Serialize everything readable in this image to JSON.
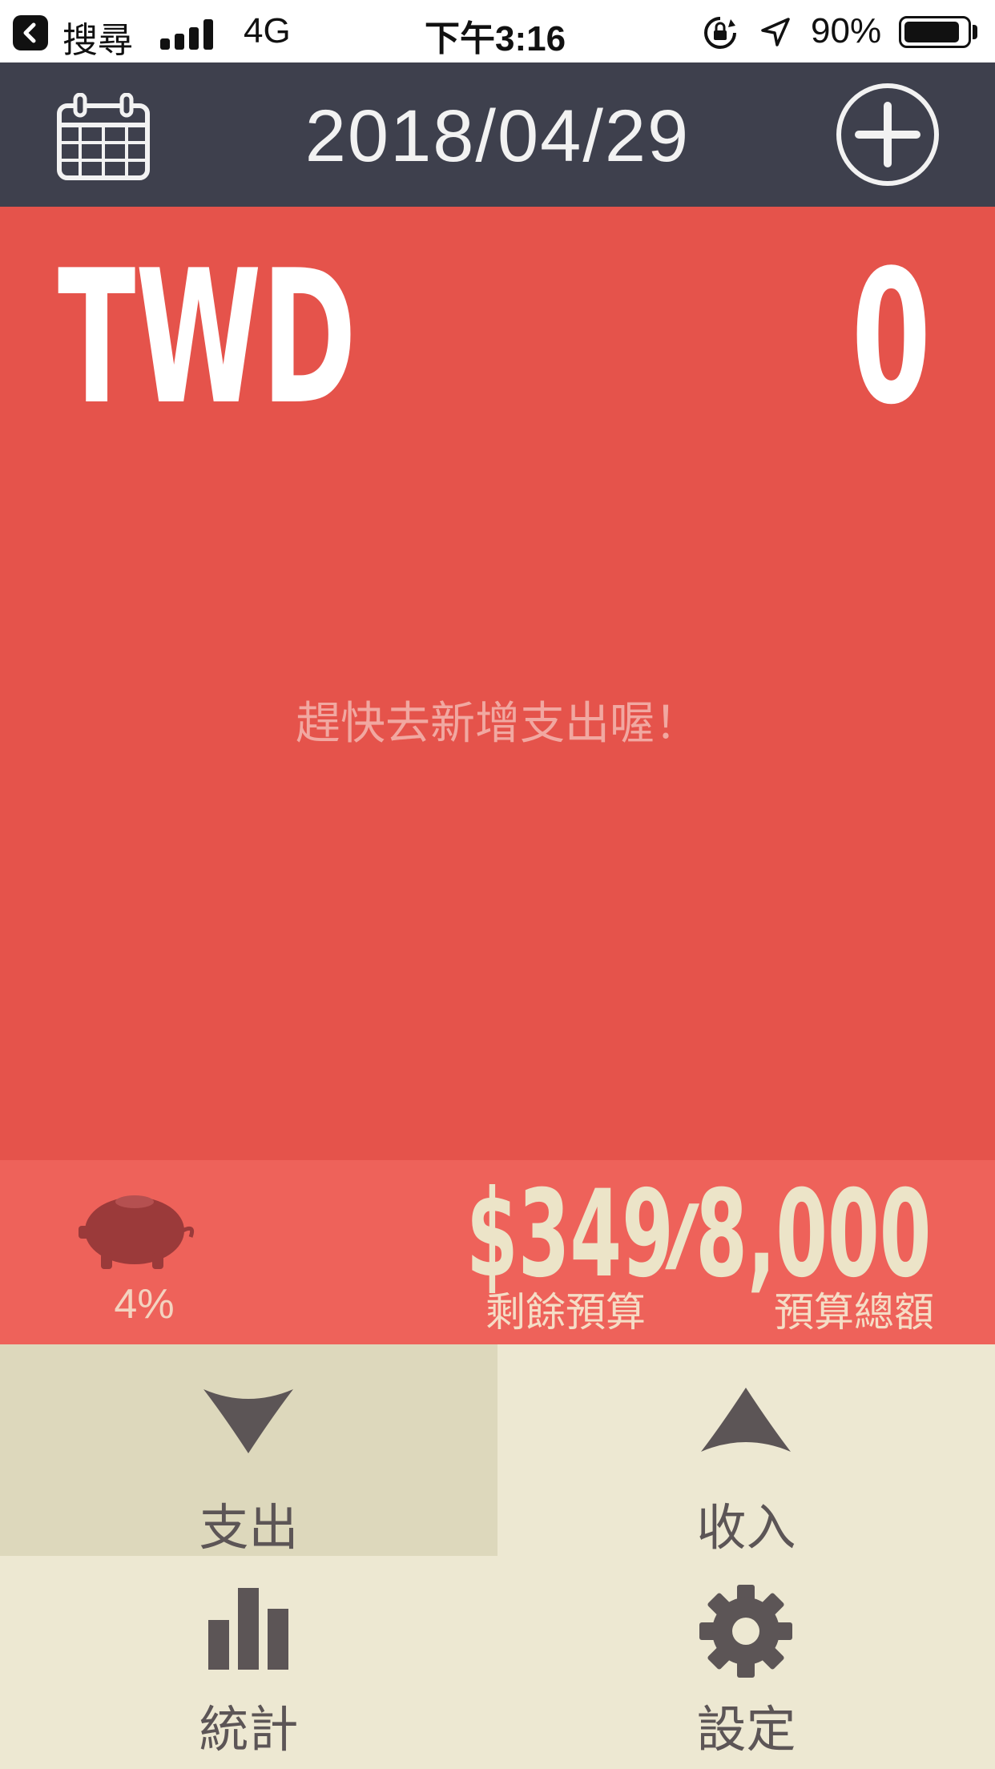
{
  "status_bar": {
    "back_label": "搜尋",
    "network": "4G",
    "time": "下午3:16",
    "battery": "90%",
    "battery_level": 0.9
  },
  "header": {
    "date": "2018/04/29",
    "calendar_icon": "calendar-icon",
    "add_icon": "plus-circle-icon"
  },
  "summary": {
    "currency": "TWD",
    "amount": "0",
    "empty_hint": "趕快去新增支出喔！"
  },
  "budget": {
    "percent": "4%",
    "remaining": "$349",
    "separator": "/",
    "total": "8,000",
    "remaining_label": "剩餘預算",
    "total_label": "預算總額",
    "icon": "piggy-bank-icon"
  },
  "nav": {
    "expense": "支出",
    "income": "收入",
    "stats": "統計",
    "settings": "設定"
  },
  "colors": {
    "header_bg": "#3e404d",
    "main_bg": "#e5534b",
    "budget_bg": "#ee625a",
    "nav_bg": "#ede8d2",
    "nav_active_bg": "#ddd8bc",
    "icon_dark": "#5c5556"
  }
}
